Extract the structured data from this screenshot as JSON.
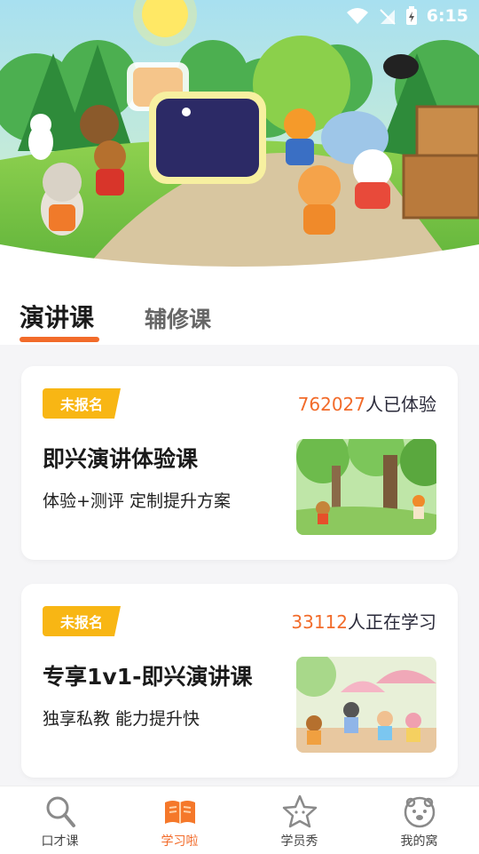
{
  "status_bar": {
    "time": "6:15"
  },
  "tabs": [
    {
      "label": "演讲课"
    },
    {
      "label": "辅修课"
    }
  ],
  "cards": [
    {
      "badge": "未报名",
      "count_number": "762027",
      "count_suffix": "人已体验",
      "title": "即兴演讲体验课",
      "subtitle": "体验+测评  定制提升方案"
    },
    {
      "badge": "未报名",
      "count_number": "33112",
      "count_suffix": "人正在学习",
      "title": "专享1v1-即兴演讲课",
      "subtitle": "独享私教  能力提升快"
    }
  ],
  "bottom_nav": [
    {
      "label": "口才课",
      "icon": "magnifier-icon"
    },
    {
      "label": "学习啦",
      "icon": "book-icon",
      "active": true
    },
    {
      "label": "学员秀",
      "icon": "star-icon"
    },
    {
      "label": "我的窝",
      "icon": "bear-face-icon"
    }
  ],
  "colors": {
    "accent": "#f26b2a",
    "badge": "#f8b614"
  }
}
